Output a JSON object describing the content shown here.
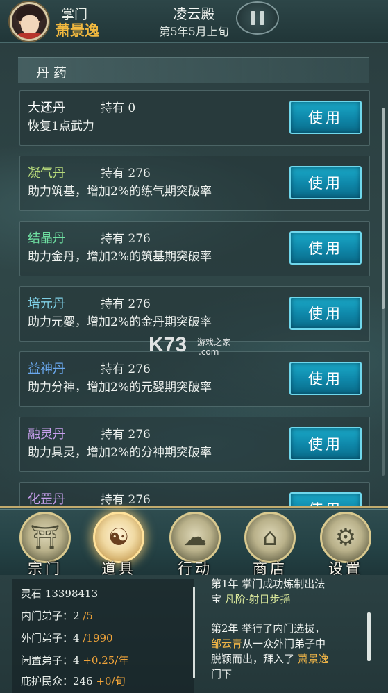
{
  "header": {
    "rank_label": "掌门",
    "player_name": "萧景逸",
    "sect_name": "凌云殿",
    "date": "第5年5月上旬"
  },
  "category": {
    "title": "丹药"
  },
  "items": [
    {
      "name": "大还丹",
      "held": "持有 0",
      "desc": "恢复1点武力",
      "button": "使用",
      "name_color": "#ffffff"
    },
    {
      "name": "凝气丹",
      "held": "持有 276",
      "desc": "助力筑基，增加2%的练气期突破率",
      "button": "使用",
      "name_color": "#b6d97a"
    },
    {
      "name": "结晶丹",
      "held": "持有 276",
      "desc": "助力金丹，增加2%的筑基期突破率",
      "button": "使用",
      "name_color": "#6fe0a2"
    },
    {
      "name": "培元丹",
      "held": "持有 276",
      "desc": "助力元婴，增加2%的金丹期突破率",
      "button": "使用",
      "name_color": "#7fd0e6"
    },
    {
      "name": "益神丹",
      "held": "持有 276",
      "desc": "助力分神，增加2%的元婴期突破率",
      "button": "使用",
      "name_color": "#6aa8ee"
    },
    {
      "name": "融灵丹",
      "held": "持有 276",
      "desc": "助力具灵，增加2%的分神期突破率",
      "button": "使用",
      "name_color": "#c9a0ee"
    },
    {
      "name": "化罡丹",
      "held": "持有 276",
      "desc": "",
      "button": "使用",
      "name_color": "#c9a0ee"
    }
  ],
  "watermark": {
    "main": "K73",
    "sub": "游戏之家",
    "domain": ".com"
  },
  "nav": [
    {
      "label": "宗门",
      "icon": "sect-gate-icon",
      "glyph": "⛩"
    },
    {
      "label": "道具",
      "icon": "item-bag-icon",
      "glyph": "☯"
    },
    {
      "label": "行动",
      "icon": "action-icon",
      "glyph": "☁"
    },
    {
      "label": "商店",
      "icon": "shop-icon",
      "glyph": "⌂"
    },
    {
      "label": "设置",
      "icon": "settings-gear-icon",
      "glyph": "⚙"
    }
  ],
  "stats": {
    "spirit_stone_label": "灵石",
    "spirit_stone_value": "13398413",
    "inner_label": "内门弟子：",
    "inner_value": "2",
    "inner_max": "/5",
    "outer_label": "外门弟子：",
    "outer_value": "4",
    "outer_max": "/1990",
    "idle_label": "闲置弟子：",
    "idle_value": "4",
    "idle_rate": "+0.25/年",
    "shelter_label": "庇护民众：",
    "shelter_value": "246",
    "shelter_rate": "+0/旬"
  },
  "log": {
    "line1": "第1年 掌门成功炼制出法",
    "line2_prefix": "宝 ",
    "line2_item": "凡阶·射日步摇",
    "line3": "第2年 举行了内门选拔，",
    "line4_name": "邹云青",
    "line4_rest": "从一众外门弟子中",
    "line5_prefix": "脱颖而出，拜入了 ",
    "line5_name": "萧景逸",
    "line6": "门下"
  },
  "colors": {
    "accent_gold": "#f0b547",
    "button_blue": "#0e86a8",
    "orange_value": "#f0a43a"
  }
}
